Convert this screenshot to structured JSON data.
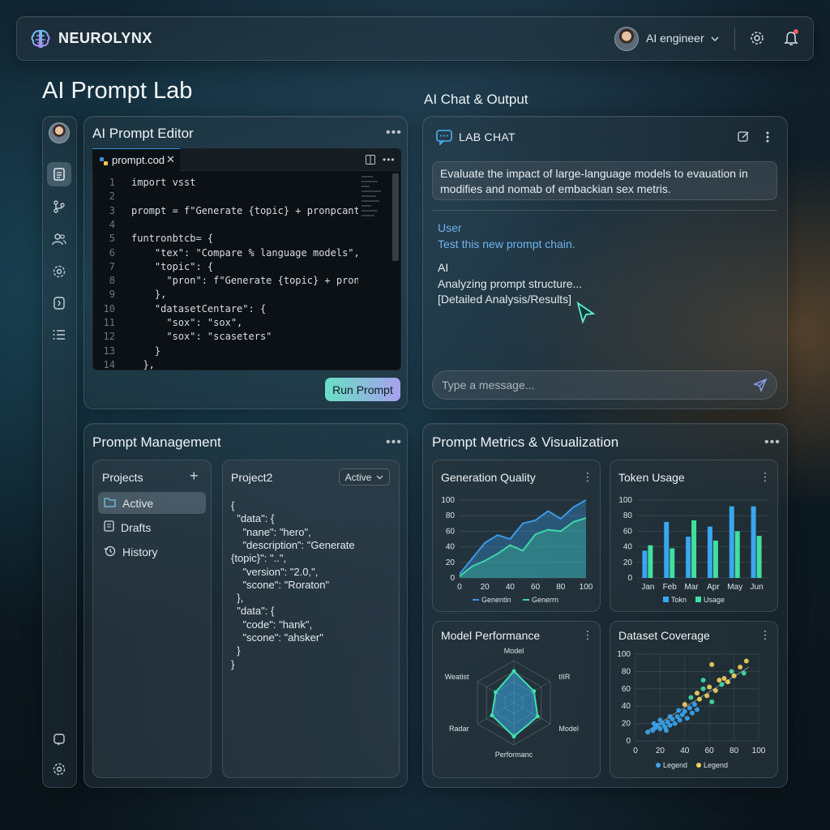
{
  "app": {
    "brand": "NEUROLYNX",
    "user_role": "AI engineer"
  },
  "page": {
    "title": "AI Prompt Lab",
    "chat_section_title": "AI Chat & Output"
  },
  "sidebar": {
    "items": [
      "document-icon",
      "branch-icon",
      "users-icon",
      "settings-icon",
      "code-file-icon",
      "list-icon",
      "chat-icon",
      "gear-icon"
    ]
  },
  "editor": {
    "title": "AI Prompt Editor",
    "tab_name": "prompt.cod",
    "line_numbers": [
      "1",
      "2",
      "3",
      "4",
      "5",
      "6",
      "7",
      "8",
      "9",
      "10",
      "11",
      "12",
      "13",
      "14"
    ],
    "lines": [
      "import vsst",
      "",
      "prompt = f\"Generate {topic} + pronpcanti",
      "",
      "funtronbtcb= {",
      "    \"tex\": \"Compare % language models\",",
      "    \"topic\": {",
      "      \"pron\": f\"Generate {topic} + pron",
      "    },",
      "    \"datasetCentare\": {",
      "      \"sox\": \"sox\",",
      "      \"sox\": \"scaseters\"",
      "    }",
      "  },"
    ],
    "run_button": "Run Prompt"
  },
  "chat": {
    "header": "LAB CHAT",
    "prompt_text": "Evaluate the impact of large-language models to evauation in modifies and nomab of embackian sex metris.",
    "user_label": "User",
    "user_message": "Test this new prompt chain.",
    "ai_label": "AI",
    "ai_message_1": "Analyzing prompt structure...",
    "ai_message_2": "[Detailed Analysis/Results]",
    "input_placeholder": "Type a message..."
  },
  "management": {
    "title": "Prompt Management",
    "projects_header": "Projects",
    "nav": [
      {
        "label": "Active",
        "icon": "folder-icon"
      },
      {
        "label": "Drafts",
        "icon": "document-icon"
      },
      {
        "label": "History",
        "icon": "history-icon"
      }
    ],
    "project_name": "Project2",
    "status": "Active",
    "json_lines": [
      "{",
      "  \"data\": {",
      "    \"nane\": \"hero\",",
      "    \"description\": \"Generate",
      "{topic}\": \"..\",",
      "    \"version\": \"2.0,\",",
      "    \"scone\": \"Roraton\"",
      "  },",
      "  \"data\": {",
      "    \"code\": \"hank\",",
      "    \"scone\": \"ahsker\"",
      "  }",
      "}"
    ]
  },
  "metrics": {
    "title": "Prompt Metrics & Visualization",
    "cards": [
      "Generation Quality",
      "Token Usage",
      "Model Performance",
      "Dataset Coverage"
    ]
  },
  "colors": {
    "accent_teal": "#3fd6a8",
    "accent_blue": "#3a9ae8",
    "accent_yellow": "#f2d45c",
    "user_blue": "#6fb2ee"
  },
  "chart_data": [
    {
      "type": "line",
      "title": "Generation Quality",
      "x": [
        0,
        10,
        20,
        30,
        40,
        50,
        60,
        70,
        80,
        90,
        100
      ],
      "xticks": [
        "0",
        "20",
        "40",
        "60",
        "80",
        "100"
      ],
      "yticks": [
        "0",
        "20",
        "40",
        "60",
        "80",
        "100"
      ],
      "ylim": [
        0,
        100
      ],
      "xlim": [
        0,
        100
      ],
      "series": [
        {
          "name": "Genentin",
          "values": [
            5,
            25,
            45,
            55,
            50,
            70,
            74,
            86,
            76,
            91,
            100
          ]
        },
        {
          "name": "Generrn",
          "values": [
            2,
            15,
            22,
            31,
            42,
            35,
            56,
            62,
            60,
            72,
            77
          ]
        }
      ]
    },
    {
      "type": "bar",
      "title": "Token Usage",
      "categories": [
        "Jan",
        "Feb",
        "Mar",
        "Apr",
        "May",
        "Jun"
      ],
      "yticks": [
        "0",
        "20",
        "40",
        "60",
        "80",
        "100"
      ],
      "ylim": [
        0,
        100
      ],
      "series": [
        {
          "name": "Tokn",
          "values": [
            35,
            72,
            53,
            66,
            92,
            92
          ]
        },
        {
          "name": "Usage",
          "values": [
            42,
            38,
            74,
            48,
            60,
            54
          ]
        }
      ]
    },
    {
      "type": "radar",
      "title": "Model Performance",
      "axes": [
        "Model",
        "tIIR",
        "Model",
        "Performanc",
        "Radar",
        "Weatist"
      ],
      "series": [
        {
          "name": "",
          "values": [
            0.75,
            0.55,
            0.65,
            0.8,
            0.6,
            0.5
          ]
        }
      ]
    },
    {
      "type": "scatter",
      "title": "Dataset Coverage",
      "xticks": [
        "0",
        "20",
        "40",
        "60",
        "80",
        "100"
      ],
      "yticks": [
        "0",
        "20",
        "40",
        "60",
        "80",
        "100"
      ],
      "xlim": [
        0,
        100
      ],
      "ylim": [
        0,
        100
      ],
      "series": [
        {
          "name": "Legend",
          "points": [
            [
              10,
              10
            ],
            [
              14,
              12
            ],
            [
              16,
              15
            ],
            [
              18,
              18
            ],
            [
              20,
              14
            ],
            [
              22,
              20
            ],
            [
              24,
              16
            ],
            [
              26,
              22
            ],
            [
              28,
              18
            ],
            [
              30,
              25
            ],
            [
              32,
              20
            ],
            [
              34,
              28
            ],
            [
              36,
              24
            ],
            [
              38,
              30
            ],
            [
              40,
              34
            ],
            [
              42,
              26
            ],
            [
              44,
              38
            ],
            [
              46,
              32
            ],
            [
              48,
              42
            ],
            [
              50,
              36
            ],
            [
              15,
              20
            ],
            [
              25,
              12
            ],
            [
              35,
              35
            ],
            [
              28,
              28
            ],
            [
              20,
              24
            ]
          ]
        },
        {
          "name": "Legend",
          "points": [
            [
              40,
              42
            ],
            [
              45,
              50
            ],
            [
              50,
              55
            ],
            [
              52,
              48
            ],
            [
              55,
              60
            ],
            [
              58,
              52
            ],
            [
              60,
              62
            ],
            [
              62,
              45
            ],
            [
              65,
              58
            ],
            [
              68,
              70
            ],
            [
              70,
              65
            ],
            [
              72,
              72
            ],
            [
              75,
              68
            ],
            [
              78,
              80
            ],
            [
              80,
              75
            ],
            [
              85,
              85
            ],
            [
              88,
              78
            ],
            [
              90,
              92
            ],
            [
              62,
              88
            ],
            [
              55,
              70
            ]
          ]
        }
      ]
    }
  ]
}
